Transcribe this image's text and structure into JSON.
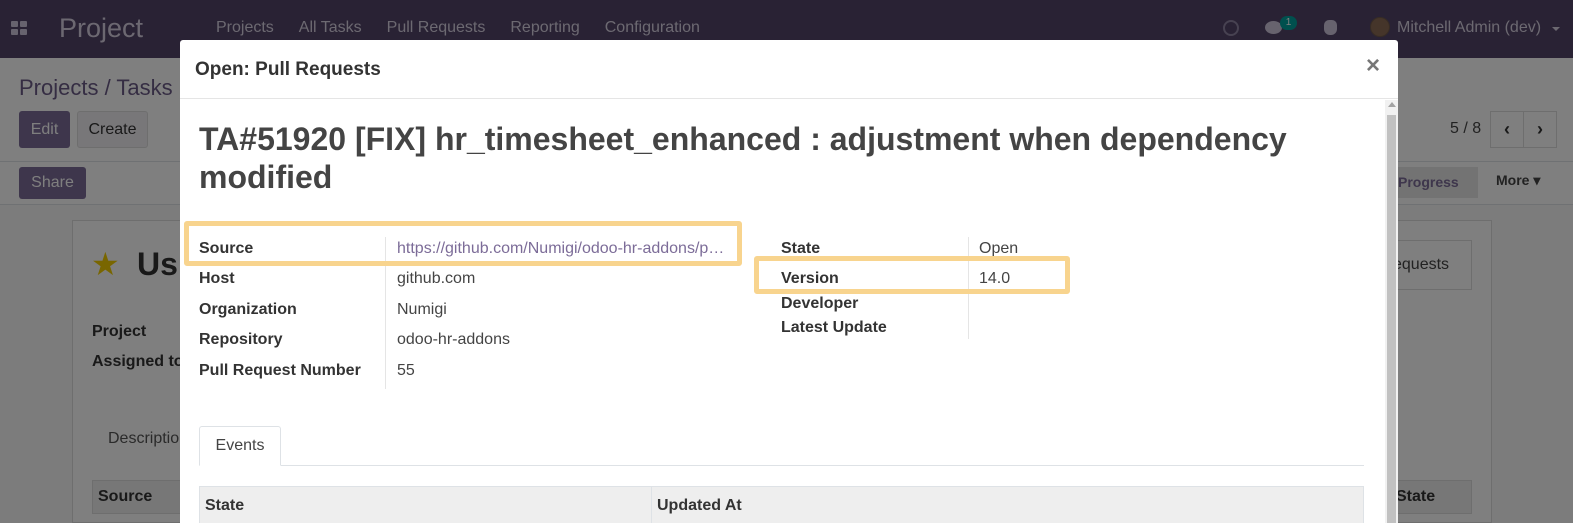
{
  "navbar": {
    "app_name": "Project",
    "menu": [
      "Projects",
      "All Tasks",
      "Pull Requests",
      "Reporting",
      "Configuration"
    ],
    "chat_badge": "1",
    "user": "Mitchell Admin (dev)",
    "icons": [
      "apps-icon",
      "clock-icon",
      "chat-icon",
      "bug-icon",
      "avatar"
    ]
  },
  "background": {
    "breadcrumb": "Projects / Tasks",
    "edit_label": "Edit",
    "create_label": "Create",
    "pager": "5 / 8",
    "share_label": "Share",
    "stage_label": "Progress",
    "more_label": "More",
    "title_fragment": "Us",
    "smart_button_fragment": "equests",
    "project_label": "Project",
    "assigned_label": "Assigned to",
    "tab_description": "Description",
    "th_source": "Source",
    "th_state": "State"
  },
  "modal": {
    "title": "Open: Pull Requests",
    "close": "×",
    "record_title": "TA#51920 [FIX] hr_timesheet_enhanced : adjustment when dependency modified",
    "left_fields": [
      {
        "label": "Source",
        "value": "https://github.com/Numigi/odoo-hr-addons/p…"
      },
      {
        "label": "Host",
        "value": "github.com"
      },
      {
        "label": "Organization",
        "value": "Numigi"
      },
      {
        "label": "Repository",
        "value": "odoo-hr-addons"
      },
      {
        "label": "Pull Request Number",
        "value": "55"
      }
    ],
    "right_fields": [
      {
        "label": "State",
        "value": "Open"
      },
      {
        "label": "Version",
        "value": "14.0"
      },
      {
        "label": "Developer",
        "value": ""
      },
      {
        "label": "Latest Update",
        "value": ""
      }
    ],
    "tab_events": "Events",
    "table_headers": [
      "State",
      "Updated At"
    ]
  },
  "colors": {
    "navbar": "#534569",
    "accent": "#7c6c98",
    "highlight": "#f8d48e"
  }
}
